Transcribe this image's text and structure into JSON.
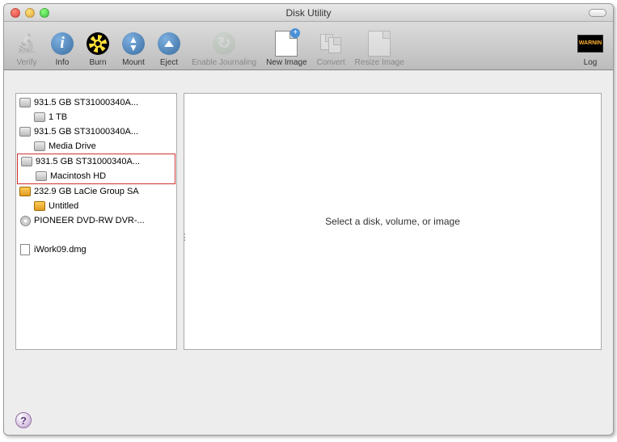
{
  "window": {
    "title": "Disk Utility"
  },
  "toolbar": {
    "verify": "Verify",
    "info": "Info",
    "burn": "Burn",
    "mount": "Mount",
    "eject": "Eject",
    "enable_journaling": "Enable Journaling",
    "new_image": "New Image",
    "convert": "Convert",
    "resize_image": "Resize Image",
    "log": "Log",
    "log_badge": "WARNIN"
  },
  "sidebar": {
    "drives": [
      {
        "label": "931.5 GB ST31000340A...",
        "volume": "1 TB",
        "icon": "internal"
      },
      {
        "label": "931.5 GB ST31000340A...",
        "volume": "Media Drive",
        "icon": "internal"
      },
      {
        "label": "931.5 GB ST31000340A...",
        "volume": "Macintosh HD",
        "icon": "internal",
        "highlighted": true
      },
      {
        "label": "232.9 GB LaCie Group SA",
        "volume": "Untitled",
        "icon": "external"
      },
      {
        "label": "PIONEER DVD-RW DVR-...",
        "volume": null,
        "icon": "optical"
      }
    ],
    "images": [
      {
        "label": "iWork09.dmg"
      }
    ]
  },
  "detail": {
    "placeholder": "Select a disk, volume, or image"
  }
}
